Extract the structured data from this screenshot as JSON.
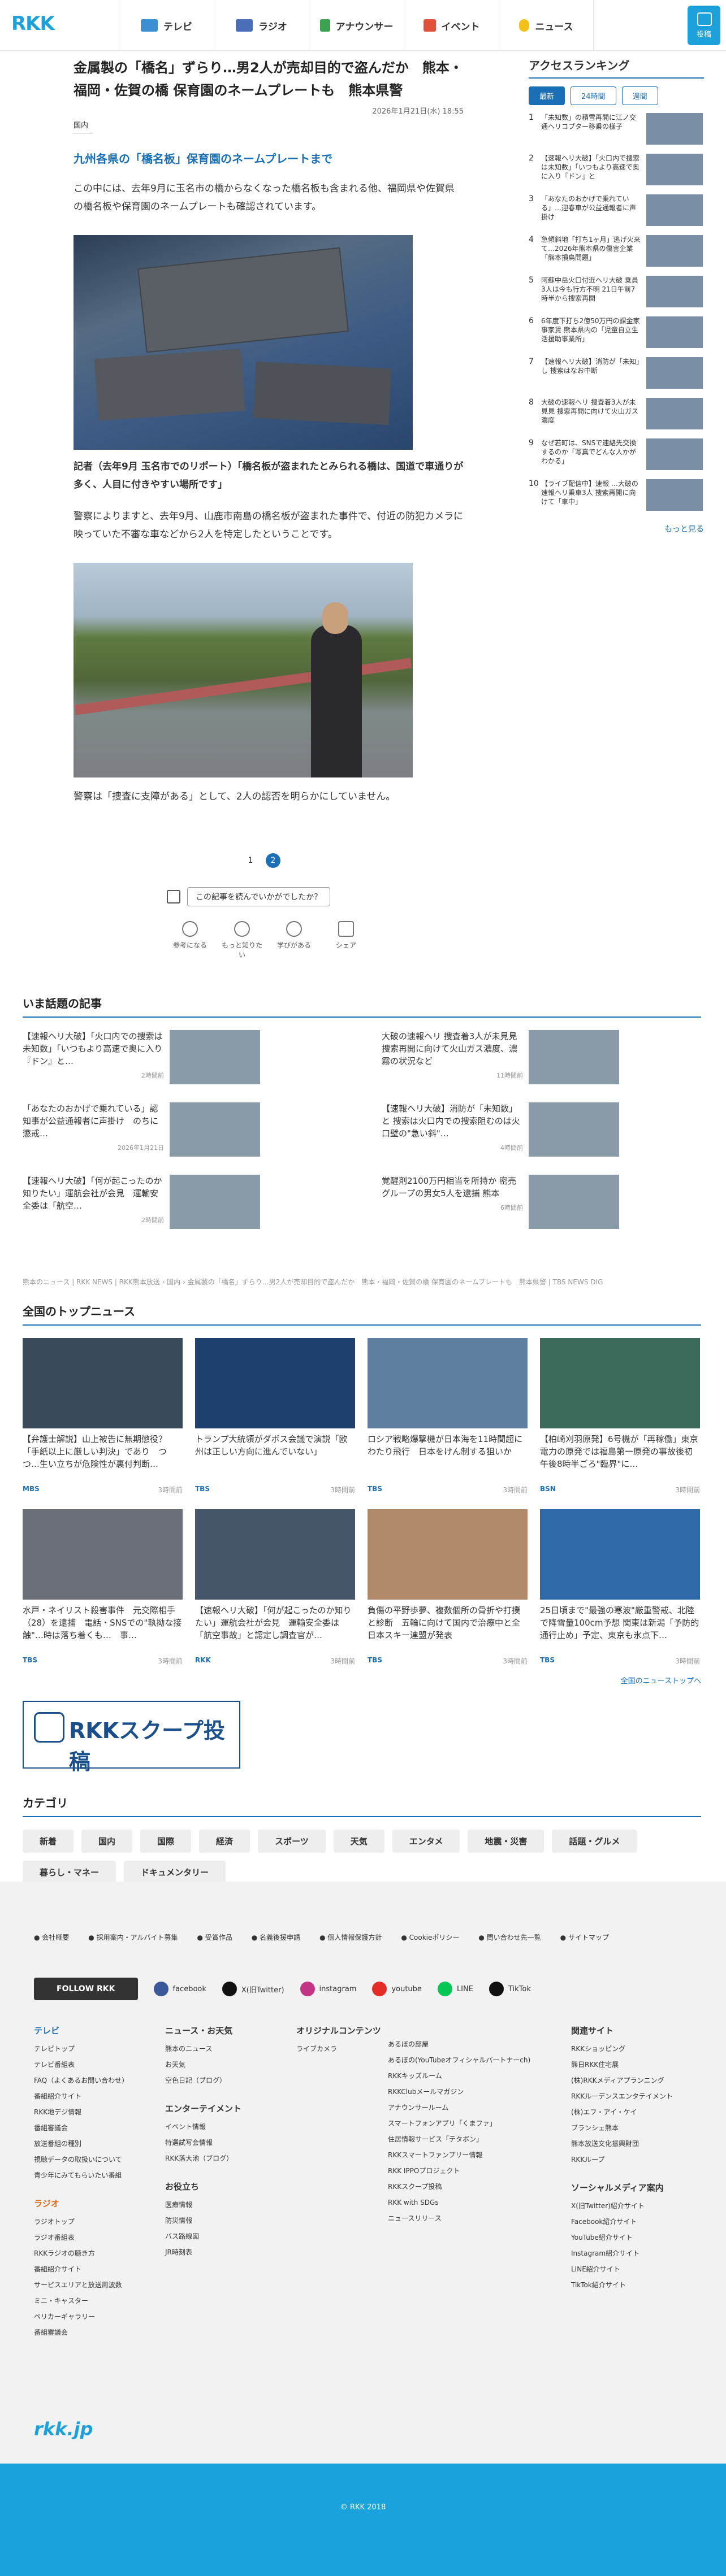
{
  "header": {
    "logo": "RKK",
    "nav": [
      "テレビ",
      "ラジオ",
      "アナウンサー",
      "イベント",
      "ニュース"
    ],
    "post": "投稿"
  },
  "article": {
    "title": "金属製の「橋名」ずらり…男2人が売却目的で盗んだか　熊本・福岡・佐賀の橋 保育園のネームプレートも　熊本県警",
    "date": "2026年1月21日(水) 18:55",
    "category": "国内",
    "subhead": "九州各県の「橋名板」保育園のネームプレートまで",
    "p1": "この中には、去年9月に玉名市の橋からなくなった橋名板も含まれる他、福岡県や佐賀県の橋名板や保育園のネームプレートも確認されています。",
    "caption1": "記者（去年9月 玉名市でのリポート）「橋名板が盗まれたとみられる橋は、国道で車通りが多く、人目に付きやすい場所です」",
    "p2": "警察によりますと、去年9月、山鹿市南島の橋名板が盗まれた事件で、付近の防犯カメラに映っていた不審な車などから2人を特定したということです。",
    "p3": "警察は「捜査に支障がある」として、2人の認否を明らかにしていません。",
    "pages": [
      "1",
      "2"
    ],
    "survey": "この記事を読んでいかがでしたか？",
    "reactions": [
      "参考になる",
      "もっと知りたい",
      "学びがある",
      "シェア"
    ]
  },
  "ranking": {
    "title": "アクセスランキング",
    "tabs": [
      "最新",
      "24時間",
      "週間"
    ],
    "more": "もっと見る",
    "items": [
      {
        "n": "1",
        "t": "「未知数」の積雪再開に江ノ交通ヘリコプター移乗の様子"
      },
      {
        "n": "2",
        "t": "【速報ヘリ大破】「火口内で捜索は未知数」「いつもより高速で奥に入り『ドン』と"
      },
      {
        "n": "3",
        "t": "「あなたのおかげで乗れている」…迎春車が公益通報者に声掛け"
      },
      {
        "n": "4",
        "t": "急傾斜地「打ち1ヶ月」逃げ火来て…2026年熊本県の傷害企業「熊本損鳥問題」"
      },
      {
        "n": "5",
        "t": "阿蘇中岳火口付近ヘリ大破 乗員3人は今も行方不明 21日午前7時半から捜索再開"
      },
      {
        "n": "6",
        "t": "6年度下打ち2億50万円の課金家事家賃 熊本県内の「児童自立生活援助事業所」"
      },
      {
        "n": "7",
        "t": "【速報ヘリ大破】消防が「未知」し 捜索はなお中断"
      },
      {
        "n": "8",
        "t": "大破の速報ヘリ 捜査着3人が未見見 捜索再開に向けて火山ガス濃度"
      },
      {
        "n": "9",
        "t": "なぜ若町は、SNSで連絡先交換するのか「写真でどんな人かがわかる」"
      },
      {
        "n": "10",
        "t": "【ライブ配信中】速報 …大破の速報ヘリ乗車3人 捜索再開に向けて「車中」"
      }
    ]
  },
  "hot": {
    "title": "いま話題の記事",
    "items": [
      {
        "t": "【速報ヘリ大破】「火口内での捜索は未知数」「いつもより高速で奥に入り『ドン』と…",
        "m": "2時間前"
      },
      {
        "t": "大破の速報ヘリ 捜査着3人が未見見　捜索再開に向けて火山ガス濃度、濃霧の状況など",
        "m": "11時間前"
      },
      {
        "t": "「あなたのおかげで乗れている」認知事が公益通報者に声掛け　のちに懲戒…",
        "m": "2026年1月21日"
      },
      {
        "t": "【速報ヘリ大破】消防が「未知数」と 捜索は火口内での捜索阻むのは火口壁の\"急い斜\"…",
        "m": "4時間前"
      },
      {
        "t": "【速報ヘリ大破】「何が起こったのか知りたい」運航会社が会見　運輸安全委は「航空…",
        "m": "2時間前"
      },
      {
        "t": "覚醒剤2100万円相当を所持か 密売グループの男女5人を逮捕 熊本",
        "m": "6時間前"
      }
    ]
  },
  "breadcrumb": "熊本のニュース | RKK NEWS | RKK熊本放送 › 国内 › 金属製の「橋名」ずらり…男2人が売却目的で盗んだか　熊本・福岡・佐賀の橋 保育園のネームプレートも　熊本県警 | TBS NEWS DIG",
  "top": {
    "title": "全国のトップニュース",
    "more": "全国のニューストップへ",
    "items": [
      {
        "t": "【弁護士解説】山上被告に無期懲役？「手紙以上に厳しい判決」であり　つつ…生い立ちが危険性が裏付判断…",
        "src": "MBS",
        "m": "3時間前"
      },
      {
        "t": "トランプ大統領がダボス会議で演説「欧州は正しい方向に進んでいない」",
        "src": "TBS",
        "m": "3時間前"
      },
      {
        "t": "ロシア戦略爆撃機が日本海を11時間超にわたり飛行　日本をけん制する狙いか",
        "src": "TBS",
        "m": "3時間前"
      },
      {
        "t": "【柏崎刈羽原発】6号機が「再稼働」東京電力の原発では福島第一原発の事故後初　午後8時半ごろ\"臨界\"に…",
        "src": "BSN",
        "m": "3時間前"
      },
      {
        "t": "水戸・ネイリスト殺害事件　元交際相手（28）を逮捕　電話・SNSでの\"執拗な接触\"…時は落ち着くも…　事…",
        "src": "TBS",
        "m": "3時間前"
      },
      {
        "t": "【速報ヘリ大破】「何が起こったのか知りたい」運航会社が会見　運輸安全委は「航空事故」と認定し調査官が…",
        "src": "RKK",
        "m": "3時間前"
      },
      {
        "t": "負傷の平野歩夢、複数個所の骨折や打撲と診断　五輪に向けて国内で治療中と全日本スキー連盟が発表",
        "src": "TBS",
        "m": "3時間前"
      },
      {
        "t": "25日頃まで\"最強の寒波\"厳重警戒、北陸で降雪量100cm予想 関東は新潟「予防的通行止め」予定、東京も氷点下…",
        "src": "TBS",
        "m": "3時間前"
      }
    ]
  },
  "banner": "RKKスクープ投稿",
  "categories": {
    "title": "カテゴリ",
    "items": [
      "新着",
      "国内",
      "国際",
      "経済",
      "スポーツ",
      "天気",
      "エンタメ",
      "地震・災害",
      "話題・グルメ",
      "暮らし・マネー",
      "ドキュメンタリー"
    ]
  },
  "footer": {
    "links": [
      "会社概要",
      "採用案内・アルバイト募集",
      "受賞作品",
      "名義後援申請",
      "個人情報保護方針",
      "Cookieポリシー",
      "問い合わせ先一覧",
      "サイトマップ"
    ],
    "follow": "FOLLOW RKK",
    "social": [
      "facebook",
      "X(旧Twitter)",
      "instagram",
      "youtube",
      "LINE",
      "TikTok"
    ],
    "social_colors": [
      "#3b5998",
      "#111111",
      "#c13584",
      "#e52d27",
      "#06c755",
      "#111111"
    ],
    "col1": {
      "h": "テレビ",
      "items": [
        "テレビトップ",
        "テレビ番組表",
        "FAQ（よくあるお問い合わせ）",
        "番組紹介サイト",
        "RKK地デジ情報",
        "番組審議会",
        "放送番組の種別",
        "視聴データの取扱いについて",
        "青少年にみてもらいたい番組"
      ]
    },
    "col1b": {
      "h": "ラジオ",
      "items": [
        "ラジオトップ",
        "ラジオ番組表",
        "RKKラジオの聴き方",
        "番組紹介サイト",
        "サービスエリアと放送周波数",
        "ミニ・キャスター",
        "ペリカーギャラリー",
        "番組審議会"
      ]
    },
    "col2": {
      "h": "ニュース・お天気",
      "items": [
        "熊本のニュース",
        "お天気",
        "空色日記（ブログ）"
      ]
    },
    "col2b": {
      "h": "エンターテイメント",
      "items": [
        "イベント情報",
        "特選試写会情報",
        "RKK落大池（ブログ）"
      ]
    },
    "col2c": {
      "h": "お役立ち",
      "items": [
        "医療情報",
        "防災情報",
        "バス路線図",
        "JR時刻表"
      ]
    },
    "col3": {
      "h": "オリジナルコンテンツ",
      "items": [
        "ライブカメラ"
      ]
    },
    "col4": {
      "h": "",
      "items": [
        "あるぼの部屋",
        "あるぼの(YouTubeオフィシャルパートナーch)",
        "RKKキッズルーム",
        "RKKClubメールマガジン",
        "アナウンサールーム",
        "スマートフォンアプリ「くまファ」",
        "住居情報サービス「テタボン」",
        "RKKスマートファンプリー情報",
        "RKK IPPOプロジェクト",
        "RKKスクープ投稿",
        "RKK with SDGs",
        "ニュースリリース"
      ]
    },
    "col5": {
      "h": "関連サイト",
      "items": [
        "RKKショッピング",
        "熊日RKK住宅展",
        "(株)RKKメディアプランニング",
        "RKKルーデンスエンタテイメント",
        "(株)エフ・アイ・ケイ",
        "ブランシェ熊本",
        "熊本放送文化振興財団",
        "RKKループ"
      ]
    },
    "col5b": {
      "h": "ソーシャルメディア案内",
      "items": [
        "X(旧Twitter)紹介サイト",
        "Facebook紹介サイト",
        "YouTube紹介サイト",
        "Instagram紹介サイト",
        "LINE紹介サイト",
        "TikTok紹介サイト"
      ]
    },
    "logo": "rkk.jp",
    "copyright": "© RKK 2018"
  }
}
